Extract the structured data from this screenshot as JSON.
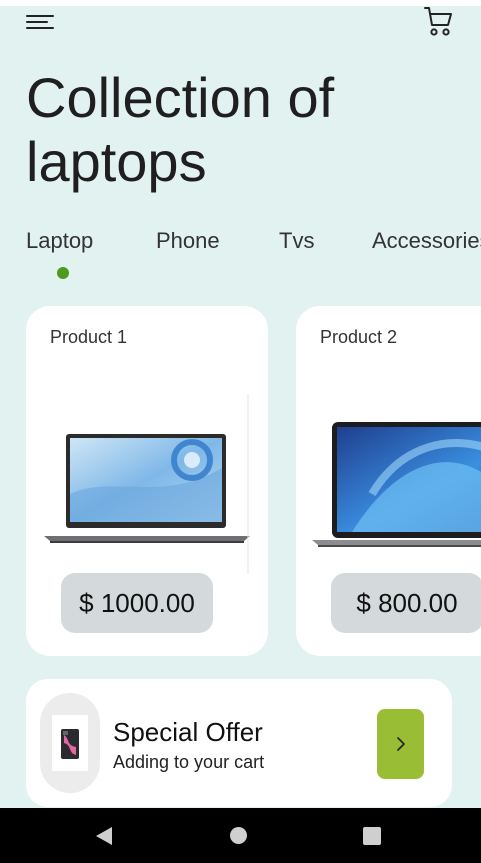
{
  "header": {
    "menu_icon": "hamburger-menu-icon",
    "cart_icon": "shopping-cart-icon",
    "title": "Collection of laptops"
  },
  "tabs": [
    {
      "label": "Laptop",
      "selected": true
    },
    {
      "label": "Phone",
      "selected": false
    },
    {
      "label": "Tvs",
      "selected": false
    },
    {
      "label": "Accessories",
      "selected": false
    }
  ],
  "products": [
    {
      "label": "Product 1",
      "price": "$ 1000.00"
    },
    {
      "label": "Product 2",
      "price": "$ 800.00"
    }
  ],
  "offer": {
    "title": "Special Offer",
    "subtitle": "Adding to your cart",
    "arrow_icon": "chevron-right-icon"
  },
  "colors": {
    "background": "#e2f2f1",
    "accent_dot": "#4e9a1c",
    "offer_button": "#99bd34",
    "price_pill": "#d4dadb"
  }
}
